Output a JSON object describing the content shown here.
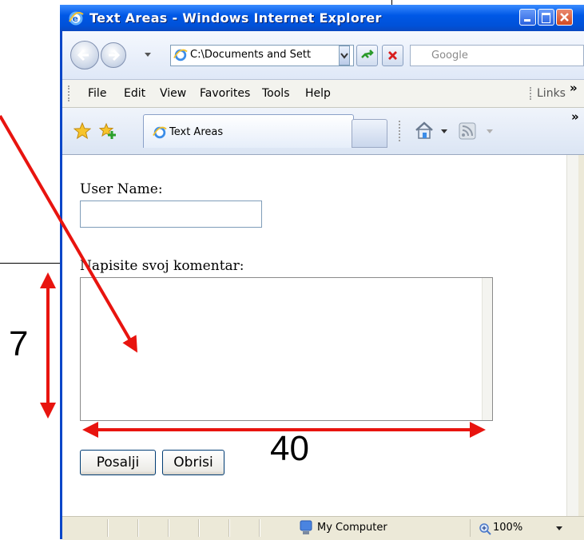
{
  "window": {
    "title": "Text Areas - Windows Internet Explorer"
  },
  "navbar": {
    "address": "C:\\Documents and Sett",
    "search_placeholder": "Google"
  },
  "menubar": {
    "items": [
      {
        "label": "File"
      },
      {
        "label": "Edit"
      },
      {
        "label": "View"
      },
      {
        "label": "Favorites"
      },
      {
        "label": "Tools"
      },
      {
        "label": "Help"
      }
    ],
    "links_label": "Links",
    "chevron": "»"
  },
  "tabs": {
    "active_tab_label": "Text Areas",
    "chevron": "»"
  },
  "form": {
    "user_label": "User Name:",
    "user_value": "",
    "comment_label": "Napisite svoj komentar:",
    "comment_value": "",
    "submit_label": "Posalji",
    "reset_label": "Obrisi"
  },
  "statusbar": {
    "zone_label": "My Computer",
    "zoom_label": "100%"
  },
  "annotations": {
    "rows_label": "7",
    "cols_label": "40",
    "arrow_color": "#e8140f"
  },
  "colors": {
    "titlebar": "#0058e6",
    "accent": "#e8140f"
  },
  "icons": [
    "ie-logo-icon",
    "back-icon",
    "forward-icon",
    "dropdown-icon",
    "go-icon",
    "stop-icon",
    "minimize-icon",
    "maximize-icon",
    "close-icon",
    "favorites-star-icon",
    "add-favorites-icon",
    "home-icon",
    "feeds-icon",
    "computer-icon",
    "zoom-icon"
  ]
}
